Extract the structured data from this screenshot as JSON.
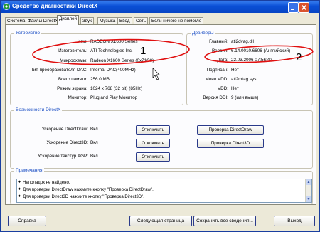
{
  "window": {
    "title": "Средство диагностики DirectX"
  },
  "tabs": [
    "Система",
    "Файлы DirectX",
    "Дисплей",
    "Звук",
    "Музыка",
    "Ввод",
    "Сеть",
    "Если ничего не помогло"
  ],
  "device": {
    "header": "Устройство",
    "rows": [
      {
        "label": "Имя:",
        "value": "RADEON X1600 Series"
      },
      {
        "label": "Изготовитель:",
        "value": "ATI Technologies Inc."
      },
      {
        "label": "Микросхемы:",
        "value": "Radeon X1600 Series (0x71C0)"
      },
      {
        "label": "Тип преобразователя DAC:",
        "value": "Internal DAC(400MHz)"
      },
      {
        "label": "Всего памяти:",
        "value": "256.0 MB"
      },
      {
        "label": "Режим экрана:",
        "value": "1024 x 768 (32 bit) (85Hz)"
      },
      {
        "label": "Монитор:",
        "value": "Plug and Play Монитор"
      }
    ]
  },
  "drivers": {
    "header": "Драйверы",
    "rows": [
      {
        "label": "Главный:",
        "value": "ati2dvag.dll"
      },
      {
        "label": "Версия:",
        "value": "6.14.0010.6606 (Английский)"
      },
      {
        "label": "Дата:",
        "value": "22.03.2006 07:56:42"
      },
      {
        "label": "Подписан:",
        "value": "Нет"
      },
      {
        "label": "Мини VDD:",
        "value": "ati2mtag.sys"
      },
      {
        "label": "VDD:",
        "value": "Нет"
      },
      {
        "label": "Версия DDI:",
        "value": "9 (или выше)"
      }
    ]
  },
  "directx": {
    "header": "Возможности DirectX",
    "features": [
      {
        "label": "Ускорение DirectDraw:",
        "state": "Вкл",
        "button": "Отключить"
      },
      {
        "label": "Ускорение Direct3D:",
        "state": "Вкл",
        "button": "Отключить"
      },
      {
        "label": "Ускорение текстур AGP:",
        "state": "Вкл",
        "button": "Отключить"
      }
    ],
    "test_draw": "Проверка DirectDraw",
    "test_3d": "Проверка Direct3D"
  },
  "notes": {
    "header": "Примечания",
    "items": [
      "Неполадок не найдено.",
      "Для проверки DirectDraw нажмите кнопку \"Проверка DirectDraw\".",
      "Для проверки Direct3D нажмите кнопку \"Проверка Direct3D\"."
    ]
  },
  "buttons": {
    "help": "Справка",
    "next": "Следующая страница",
    "save": "Сохранить все сведения...",
    "exit": "Выход"
  },
  "annotations": [
    "1",
    "2"
  ],
  "colors": {
    "annotation": "#e01010",
    "titlebar": "#0a4fd6",
    "group_label": "#1c4fc4"
  }
}
